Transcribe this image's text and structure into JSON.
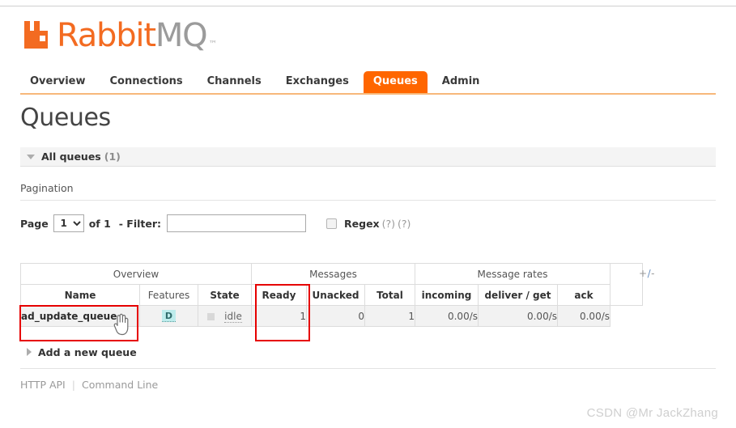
{
  "brand": {
    "name_primary": "Rabbit",
    "name_secondary": "MQ",
    "trademark": "™",
    "orange": "#f36b21",
    "gray": "#9b9b9b"
  },
  "nav": {
    "items": [
      {
        "label": "Overview",
        "active": false
      },
      {
        "label": "Connections",
        "active": false
      },
      {
        "label": "Channels",
        "active": false
      },
      {
        "label": "Exchanges",
        "active": false
      },
      {
        "label": "Queues",
        "active": true
      },
      {
        "label": "Admin",
        "active": false
      }
    ],
    "active_color": "#ff6600"
  },
  "page": {
    "title": "Queues"
  },
  "section": {
    "title": "All queues",
    "count": "(1)",
    "collapsed": false
  },
  "pagination": {
    "label": "Pagination",
    "page_word": "Page",
    "page_value": "1",
    "page_options": [
      "1"
    ],
    "of_text": "of 1",
    "filter_label": "- Filter:",
    "filter_value": "",
    "filter_placeholder": "",
    "regex_label": "Regex",
    "regex_checked": false,
    "help_1": "(?)",
    "help_2": "(?)"
  },
  "table": {
    "group_headers": [
      {
        "label": "Overview",
        "span": 3
      },
      {
        "label": "Messages",
        "span": 3
      },
      {
        "label": "Message rates",
        "span": 3
      }
    ],
    "columns": [
      {
        "label": "Name",
        "bold": true
      },
      {
        "label": "Features",
        "bold": false
      },
      {
        "label": "State",
        "bold": true
      },
      {
        "label": "Ready",
        "bold": true
      },
      {
        "label": "Unacked",
        "bold": true
      },
      {
        "label": "Total",
        "bold": true
      },
      {
        "label": "incoming",
        "bold": true
      },
      {
        "label": "deliver / get",
        "bold": true
      },
      {
        "label": "ack",
        "bold": true
      }
    ],
    "toggle_columns": "+/-",
    "rows": [
      {
        "name": "ad_update_queue",
        "features": "D",
        "state": "idle",
        "ready": "1",
        "unacked": "0",
        "total": "1",
        "incoming": "0.00/s",
        "deliver_get": "0.00/s",
        "ack": "0.00/s"
      }
    ]
  },
  "add_queue": {
    "label": "Add a new queue",
    "expanded": false
  },
  "footer": {
    "http_api": "HTTP API",
    "separator": "|",
    "command_line": "Command Line"
  },
  "watermark": {
    "text": "CSDN @Mr JackZhang"
  },
  "annotations": {
    "highlight_color": "#e60000",
    "boxes": [
      "queue-name-cell",
      "ready-column"
    ]
  }
}
